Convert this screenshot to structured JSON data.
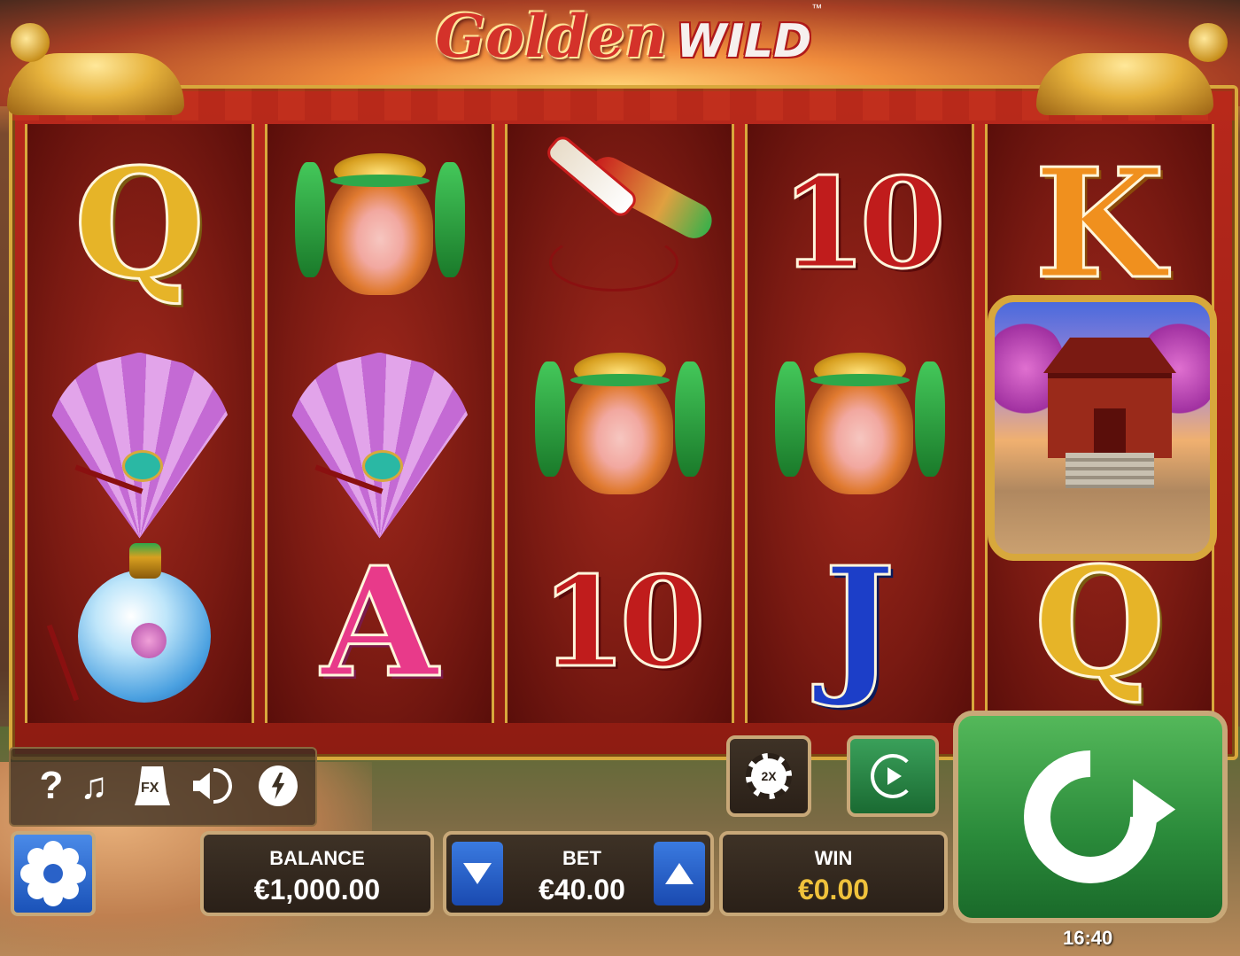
{
  "title": {
    "main": "Golden",
    "accent": "WILD",
    "tm": "™"
  },
  "reels": [
    [
      {
        "type": "letter",
        "cls": "q",
        "text": "Q"
      },
      {
        "type": "fan"
      },
      {
        "type": "bottle"
      }
    ],
    [
      {
        "type": "pot"
      },
      {
        "type": "fan"
      },
      {
        "type": "letter",
        "cls": "a",
        "text": "A"
      }
    ],
    [
      {
        "type": "knife"
      },
      {
        "type": "pot"
      },
      {
        "type": "letter",
        "cls": "ten",
        "text": "10"
      }
    ],
    [
      {
        "type": "letter",
        "cls": "ten",
        "text": "10"
      },
      {
        "type": "pot"
      },
      {
        "type": "letter",
        "cls": "j",
        "text": "J"
      }
    ],
    [
      {
        "type": "letter",
        "cls": "k",
        "text": "K"
      },
      {
        "type": "wild"
      },
      {
        "type": "letter",
        "cls": "q",
        "text": "Q"
      }
    ]
  ],
  "controls": {
    "help": "?",
    "music": "♫",
    "fx": "FX",
    "chip": "2X",
    "balance_label": "BALANCE",
    "balance_value": "€1,000.00",
    "bet_label": "BET",
    "bet_value": "€40.00",
    "win_label": "WIN",
    "win_value": "€0.00",
    "clock": "16:40"
  }
}
